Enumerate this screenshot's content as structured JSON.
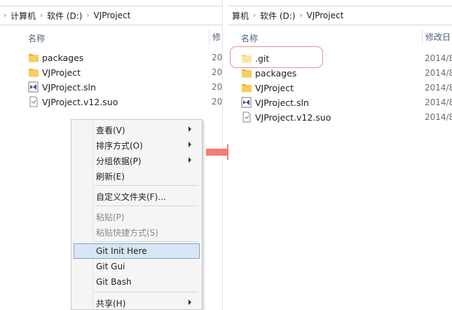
{
  "left": {
    "breadcrumb": [
      "计算机",
      "软件 (D:)",
      "VJProject"
    ],
    "col_name": "名称",
    "col_date": "修",
    "files": [
      {
        "name": "packages",
        "type": "folder",
        "date": "20"
      },
      {
        "name": "VJProject",
        "type": "folder",
        "date": "20"
      },
      {
        "name": "VJProject.sln",
        "type": "sln",
        "date": "20"
      },
      {
        "name": "VJProject.v12.suo",
        "type": "suo",
        "date": "20"
      }
    ]
  },
  "right": {
    "breadcrumb": [
      "算机",
      "软件 (D:)",
      "VJProject"
    ],
    "col_name": "名称",
    "col_date": "修改日",
    "files": [
      {
        "name": ".git",
        "type": "folder",
        "date": "2014/8"
      },
      {
        "name": "packages",
        "type": "folder",
        "date": "2014/8"
      },
      {
        "name": "VJProject",
        "type": "folder",
        "date": "2014/8"
      },
      {
        "name": "VJProject.sln",
        "type": "sln",
        "date": "2014/8"
      },
      {
        "name": "VJProject.v12.suo",
        "type": "suo",
        "date": "2014/8"
      }
    ]
  },
  "context_menu": {
    "items": [
      {
        "label": "查看(V)",
        "submenu": true
      },
      {
        "label": "排序方式(O)",
        "submenu": true
      },
      {
        "label": "分组依据(P)",
        "submenu": true
      },
      {
        "label": "刷新(E)"
      },
      {
        "label": "自定义文件夹(F)..."
      },
      {
        "label": "粘贴(P)",
        "disabled": true
      },
      {
        "label": "粘贴快捷方式(S)",
        "disabled": true
      },
      {
        "label": "Git Init Here",
        "highlighted": true
      },
      {
        "label": "Git Gui"
      },
      {
        "label": "Git Bash"
      },
      {
        "label": "共享(H)",
        "submenu": true
      }
    ]
  },
  "colors": {
    "arrow": "#f27e74",
    "highlight_ring": "#e8908f",
    "menu_highlight": "#d8e6f4",
    "folder": "#f5c343"
  },
  "icons": {
    "folder": "folder-icon",
    "sln": "visual-studio-solution-icon",
    "suo": "suo-file-icon",
    "submenu": "chevron-right-icon",
    "transition": "right-arrow-icon"
  }
}
